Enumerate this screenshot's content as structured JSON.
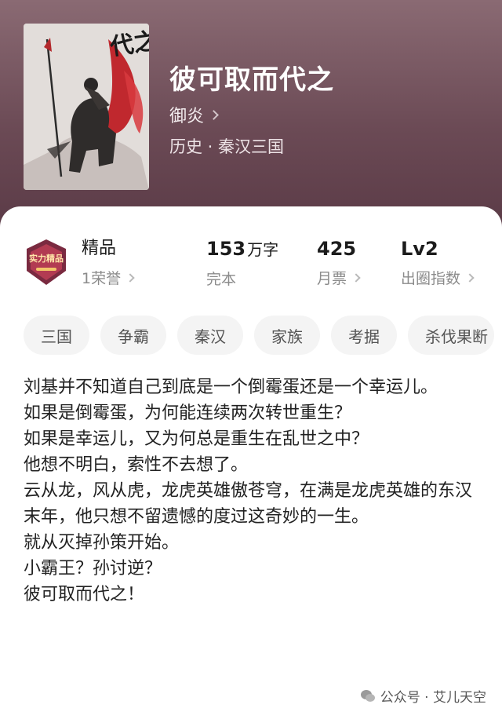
{
  "book": {
    "title": "彼可取而代之",
    "author": "御炎",
    "genre": "历史 · 秦汉三国"
  },
  "cover": {
    "calligraphy": "代之"
  },
  "badge": {
    "title": "精品",
    "honors": "1荣誉",
    "seal_text": "实力精品"
  },
  "stats": {
    "words": {
      "value": "153",
      "unit": "万字",
      "label": "完本"
    },
    "tickets": {
      "value": "425",
      "label": "月票"
    },
    "level": {
      "value": "Lv2",
      "label": "出圈指数"
    }
  },
  "tags": [
    "三国",
    "争霸",
    "秦汉",
    "家族",
    "考据",
    "杀伐果断"
  ],
  "description": [
    "刘基并不知道自己到底是一个倒霉蛋还是一个幸运儿。",
    "如果是倒霉蛋，为何能连续两次转世重生？",
    "如果是幸运儿，又为何总是重生在乱世之中？",
    "他想不明白，索性不去想了。",
    "云从龙，风从虎，龙虎英雄傲苍穹，在满是龙虎英雄的东汉末年，他只想不留遗憾的度过这奇妙的一生。",
    "就从灭掉孙策开始。",
    "小霸王？孙讨逆？",
    "彼可取而代之！"
  ],
  "watermark": "公众号 · 艾儿天空",
  "colors": {
    "header": "#6b4a55",
    "cover_red": "#c0282e"
  }
}
